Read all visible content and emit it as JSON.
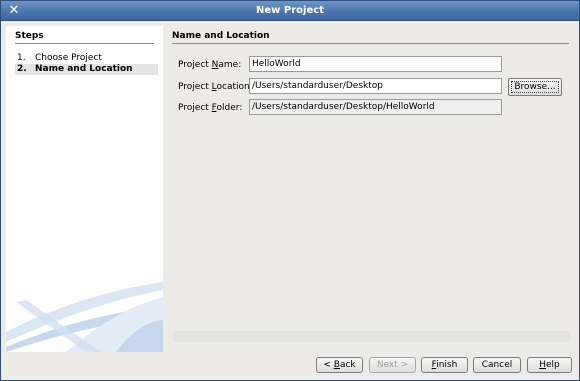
{
  "window": {
    "title": "New Project",
    "close_glyph": "✕"
  },
  "steps": {
    "title": "Steps",
    "items": [
      {
        "num": "1.",
        "label": "Choose Project"
      },
      {
        "num": "2.",
        "label": "Name and Location"
      }
    ],
    "active_index": 1
  },
  "content": {
    "title": "Name and Location",
    "project_name": {
      "label_pre": "Project ",
      "label_mnemonic": "N",
      "label_post": "ame:",
      "value": "HelloWorld"
    },
    "project_location": {
      "label_pre": "Project ",
      "label_mnemonic": "L",
      "label_post": "ocation:",
      "value": "/Users/standarduser/Desktop"
    },
    "project_folder": {
      "label_pre": "Project ",
      "label_mnemonic": "F",
      "label_post": "older:",
      "value": "/Users/standarduser/Desktop/HelloWorld"
    },
    "browse_label": "Browse..."
  },
  "buttons": {
    "back": {
      "pre": "< ",
      "mnemonic": "B",
      "post": "ack"
    },
    "next": "Next >",
    "finish": {
      "mnemonic": "F",
      "post": "inish"
    },
    "cancel": "Cancel",
    "help": {
      "mnemonic": "H",
      "post": "elp"
    }
  },
  "colors": {
    "titlebar": "#4c76ad",
    "panel_bg": "#ecebe8",
    "steps_bg": "#ffffff"
  },
  "icons": {
    "close": "close-icon",
    "decoration": "decorative-swoosh-art"
  }
}
